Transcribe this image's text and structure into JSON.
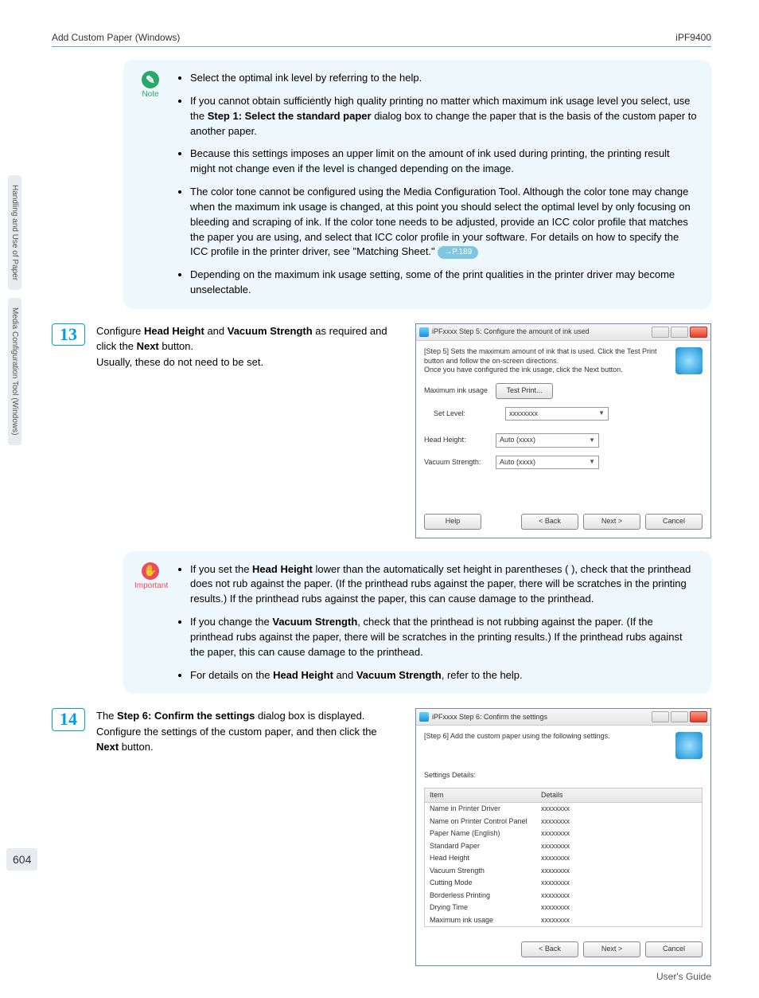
{
  "header": {
    "left": "Add Custom Paper (Windows)",
    "right": "iPF9400"
  },
  "sidetabs": [
    "Handling and Use of Paper",
    "Media Configuration Tool (Windows)"
  ],
  "page_number": "604",
  "note": {
    "icon_label": "Note",
    "items": {
      "b1": "Select the optimal ink level by referring to the help.",
      "b2_pre": "If you cannot obtain sufficiently high quality printing no matter which maximum ink usage level you select, use the ",
      "b2_strong": "Step 1: Select the standard paper",
      "b2_post": " dialog box to change the paper that is the basis of the custom paper to another paper.",
      "b3": "Because this settings imposes an upper limit on the amount of ink used during printing, the printing result might not change even if the level is changed depending on the image.",
      "b4_main": "The color tone cannot be configured using the Media Configuration Tool. Although the color tone may change when the maximum ink usage is changed, at this point you should select the optimal level by only focusing on bleeding and scraping of ink. If the color tone needs to be adjusted, provide an ICC color profile that matches the paper you are using, and select that ICC color profile in your software. For details on how to specify the ICC profile in the printer driver, see \"Matching Sheet.\"",
      "b4_ref": "→P.189",
      "b5": "Depending on the maximum ink usage setting, some of the print qualities in the printer driver may become unselectable."
    }
  },
  "step13": {
    "num": "13",
    "text_p1": "Configure ",
    "text_s1": "Head Height",
    "text_p2": " and ",
    "text_s2": "Vacuum Strength",
    "text_p3": " as required and click the ",
    "text_s3": "Next",
    "text_p4": " button.",
    "text_line2": "Usually, these do not need to be set.",
    "dialog": {
      "title": "iPFxxxx Step 5: Configure the amount of ink used",
      "desc": "[Step 5] Sets the maximum amount of ink that is used. Click the Test Print button and follow the on-screen directions.\nOnce you have configured the ink usage, click the Next button.",
      "labels": {
        "max_ink": "Maximum ink usage",
        "set_level": "Set Level:",
        "head_height": "Head Height:",
        "vacuum": "Vacuum Strength:"
      },
      "buttons": {
        "test_print": "Test Print...",
        "help": "Help",
        "back": "< Back",
        "next": "Next >",
        "cancel": "Cancel"
      },
      "values": {
        "set_level": "xxxxxxxx",
        "head_height": "Auto (xxxx)",
        "vacuum": "Auto (xxxx)"
      }
    }
  },
  "important": {
    "icon_label": "Important",
    "b1_pre": "If you set the ",
    "b1_s1": "Head Height",
    "b1_post": " lower than the automatically set height in parentheses ( ), check that the printhead does not rub against the paper. (If the printhead rubs against the paper, there will be scratches in the printing results.) If the printhead rubs against the paper, this can cause damage to the printhead.",
    "b2_pre": "If you change the ",
    "b2_s1": "Vacuum Strength",
    "b2_post": ", check that the printhead is not rubbing against the paper. (If the printhead rubs against the paper, there will be scratches in the printing results.) If the printhead rubs against the paper, this can cause damage to the printhead.",
    "b3_pre": "For details on the ",
    "b3_s1": "Head Height",
    "b3_mid": " and ",
    "b3_s2": "Vacuum Strength",
    "b3_post": ", refer to the help."
  },
  "step14": {
    "num": "14",
    "t1": "The ",
    "s1": "Step 6: Confirm the settings",
    "t2": " dialog box is displayed.",
    "line2_a": "Configure the settings of the custom paper, and then click the ",
    "line2_s": "Next",
    "line2_b": " button.",
    "dialog": {
      "title": "iPFxxxx Step 6: Confirm the settings",
      "desc": "[Step 6] Add the custom paper using the following settings.",
      "settings_label": "Settings Details:",
      "hdr_item": "Item",
      "hdr_details": "Details",
      "rows": [
        {
          "k": "Name in Printer Driver",
          "v": "xxxxxxxx"
        },
        {
          "k": "Name on Printer Control Panel",
          "v": "xxxxxxxx"
        },
        {
          "k": "Paper Name (English)",
          "v": "xxxxxxxx"
        },
        {
          "k": "Standard Paper",
          "v": "xxxxxxxx"
        },
        {
          "k": "Head Height",
          "v": "xxxxxxxx"
        },
        {
          "k": "Vacuum Strength",
          "v": "xxxxxxxx"
        },
        {
          "k": "Cutting Mode",
          "v": "xxxxxxxx"
        },
        {
          "k": "Borderless Printing",
          "v": "xxxxxxxx"
        },
        {
          "k": "Drying Time",
          "v": "xxxxxxxx"
        },
        {
          "k": "Maximum ink usage",
          "v": "xxxxxxxx"
        }
      ],
      "buttons": {
        "back": "< Back",
        "next": "Next >",
        "cancel": "Cancel"
      }
    }
  },
  "footer": "User's Guide"
}
